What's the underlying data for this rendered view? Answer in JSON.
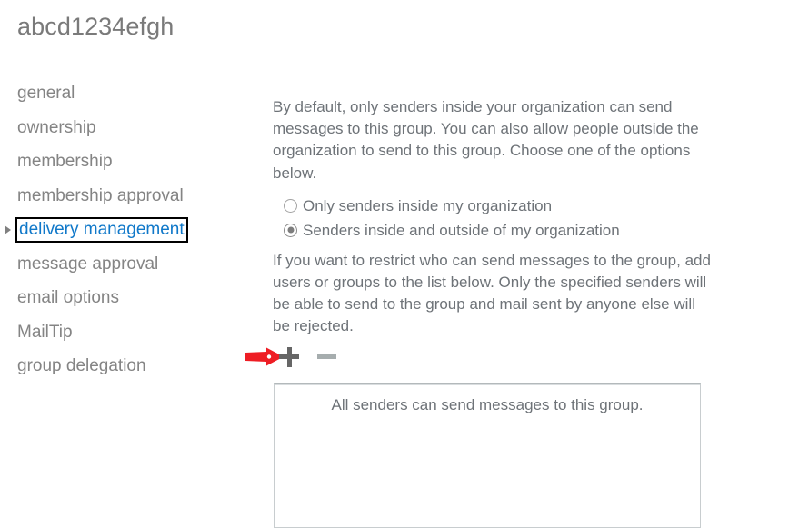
{
  "page": {
    "title": "abcd1234efgh"
  },
  "sidebar": {
    "items": [
      {
        "label": "general",
        "selected": false
      },
      {
        "label": "ownership",
        "selected": false
      },
      {
        "label": "membership",
        "selected": false
      },
      {
        "label": "membership approval",
        "selected": false
      },
      {
        "label": "delivery management",
        "selected": true
      },
      {
        "label": "message approval",
        "selected": false
      },
      {
        "label": "email options",
        "selected": false
      },
      {
        "label": "MailTip",
        "selected": false
      },
      {
        "label": "group delegation",
        "selected": false
      }
    ],
    "selected_caret_icon": "caret-right-icon",
    "text_color": "#848484",
    "selected_color": "#1078c9"
  },
  "main": {
    "intro_paragraph": "By default, only senders inside your organization can send messages to this group. You can also allow people outside the organization to send to this group. Choose one of the options below.",
    "radio_options": [
      {
        "label": "Only senders inside my organization",
        "checked": false
      },
      {
        "label": "Senders inside and outside of my organization",
        "checked": true
      }
    ],
    "restrict_paragraph": "If you want to restrict who can send messages to the group, add users or groups to the list below. Only the specified senders will be able to send to the group and mail sent by anyone else will be rejected.",
    "toolbar": {
      "add_icon": "plus-icon",
      "remove_icon": "minus-icon",
      "add_enabled": true,
      "remove_enabled": false
    },
    "listbox": {
      "empty_message": "All senders can send messages to this group."
    },
    "text_color": "#6e7378"
  },
  "annotation": {
    "arrow_icon": "red-arrow-right-icon",
    "color": "#ee1d24"
  }
}
